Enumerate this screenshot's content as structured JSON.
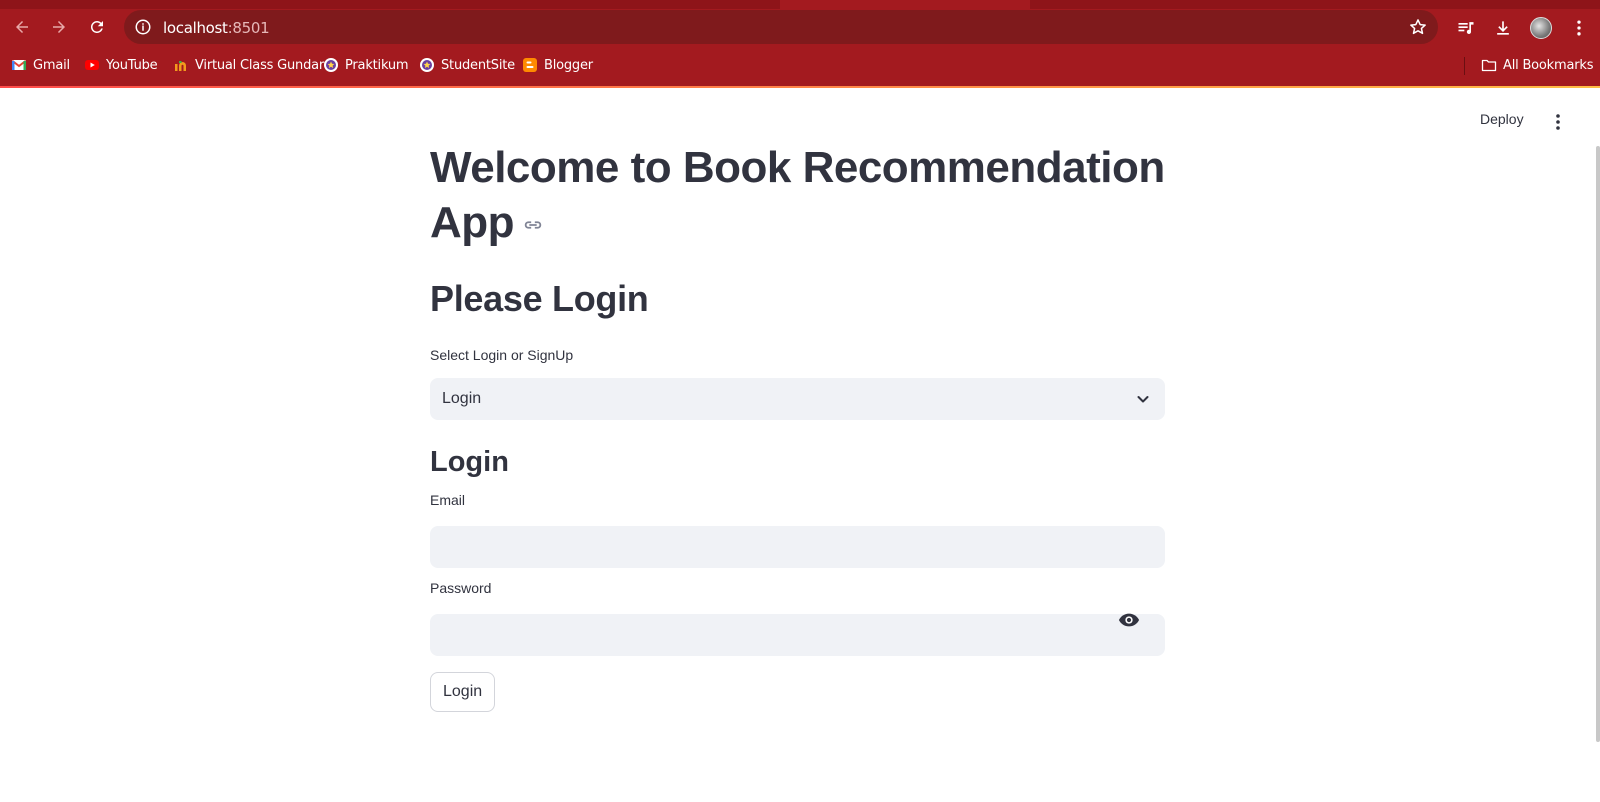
{
  "browser": {
    "url_host": "localhost",
    "url_port": ":8501",
    "bookmarks": [
      {
        "label": "Gmail",
        "icon": "gmail-icon"
      },
      {
        "label": "YouTube",
        "icon": "youtube-icon"
      },
      {
        "label": "Virtual Class Gundar",
        "icon": "virtual-class-icon"
      },
      {
        "label": "Praktikum",
        "icon": "praktikum-icon"
      },
      {
        "label": "StudentSite",
        "icon": "studentsite-icon"
      },
      {
        "label": "Blogger",
        "icon": "blogger-icon"
      }
    ],
    "all_bookmarks_label": "All Bookmarks",
    "colors": {
      "chrome": "#a31a1f",
      "omnibox": "#7f1a1c"
    }
  },
  "app": {
    "deploy_label": "Deploy",
    "title": "Welcome to Book Recommendation App",
    "subtitle": "Please Login",
    "select": {
      "label": "Select Login or SignUp",
      "value": "Login"
    },
    "section_title": "Login",
    "email": {
      "label": "Email",
      "value": ""
    },
    "password": {
      "label": "Password",
      "value": ""
    },
    "submit_label": "Login",
    "colors": {
      "text": "#31333f",
      "input_bg": "#f0f2f6"
    }
  }
}
